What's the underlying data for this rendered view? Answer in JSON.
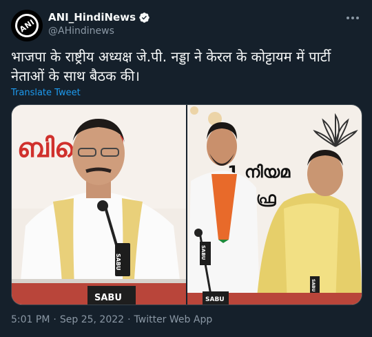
{
  "author": {
    "display_name": "ANI_HindiNews",
    "handle": "@AHindinews",
    "avatar_text": "ANI"
  },
  "tweet": {
    "text": "भाजपा के राष्ट्रीय अध्यक्ष जे.पी. नड्डा ने केरल के कोट्टायम में पार्टी नेताओं के साथ बैठक की।",
    "translate_label": "Translate Tweet"
  },
  "media": {
    "photo1_banner": "ബിജെപി",
    "photo1_mic_label": "SABU",
    "photo1_desk_label": "SABU",
    "photo2_banner_line1": "1 നിയമ",
    "photo2_banner_line2": "ഫ്ര",
    "photo2_mic_label": "SABU",
    "photo2_desk_label": "SABU",
    "photo2_mic2_label": "SABU"
  },
  "meta": {
    "time": "5:01 PM",
    "date": "Sep 25, 2022",
    "source": "Twitter Web App",
    "separator": "·"
  },
  "colors": {
    "background": "#15202b",
    "link": "#1d9bf0",
    "secondary_text": "#8b98a5",
    "verified": "#1d9bf0"
  }
}
